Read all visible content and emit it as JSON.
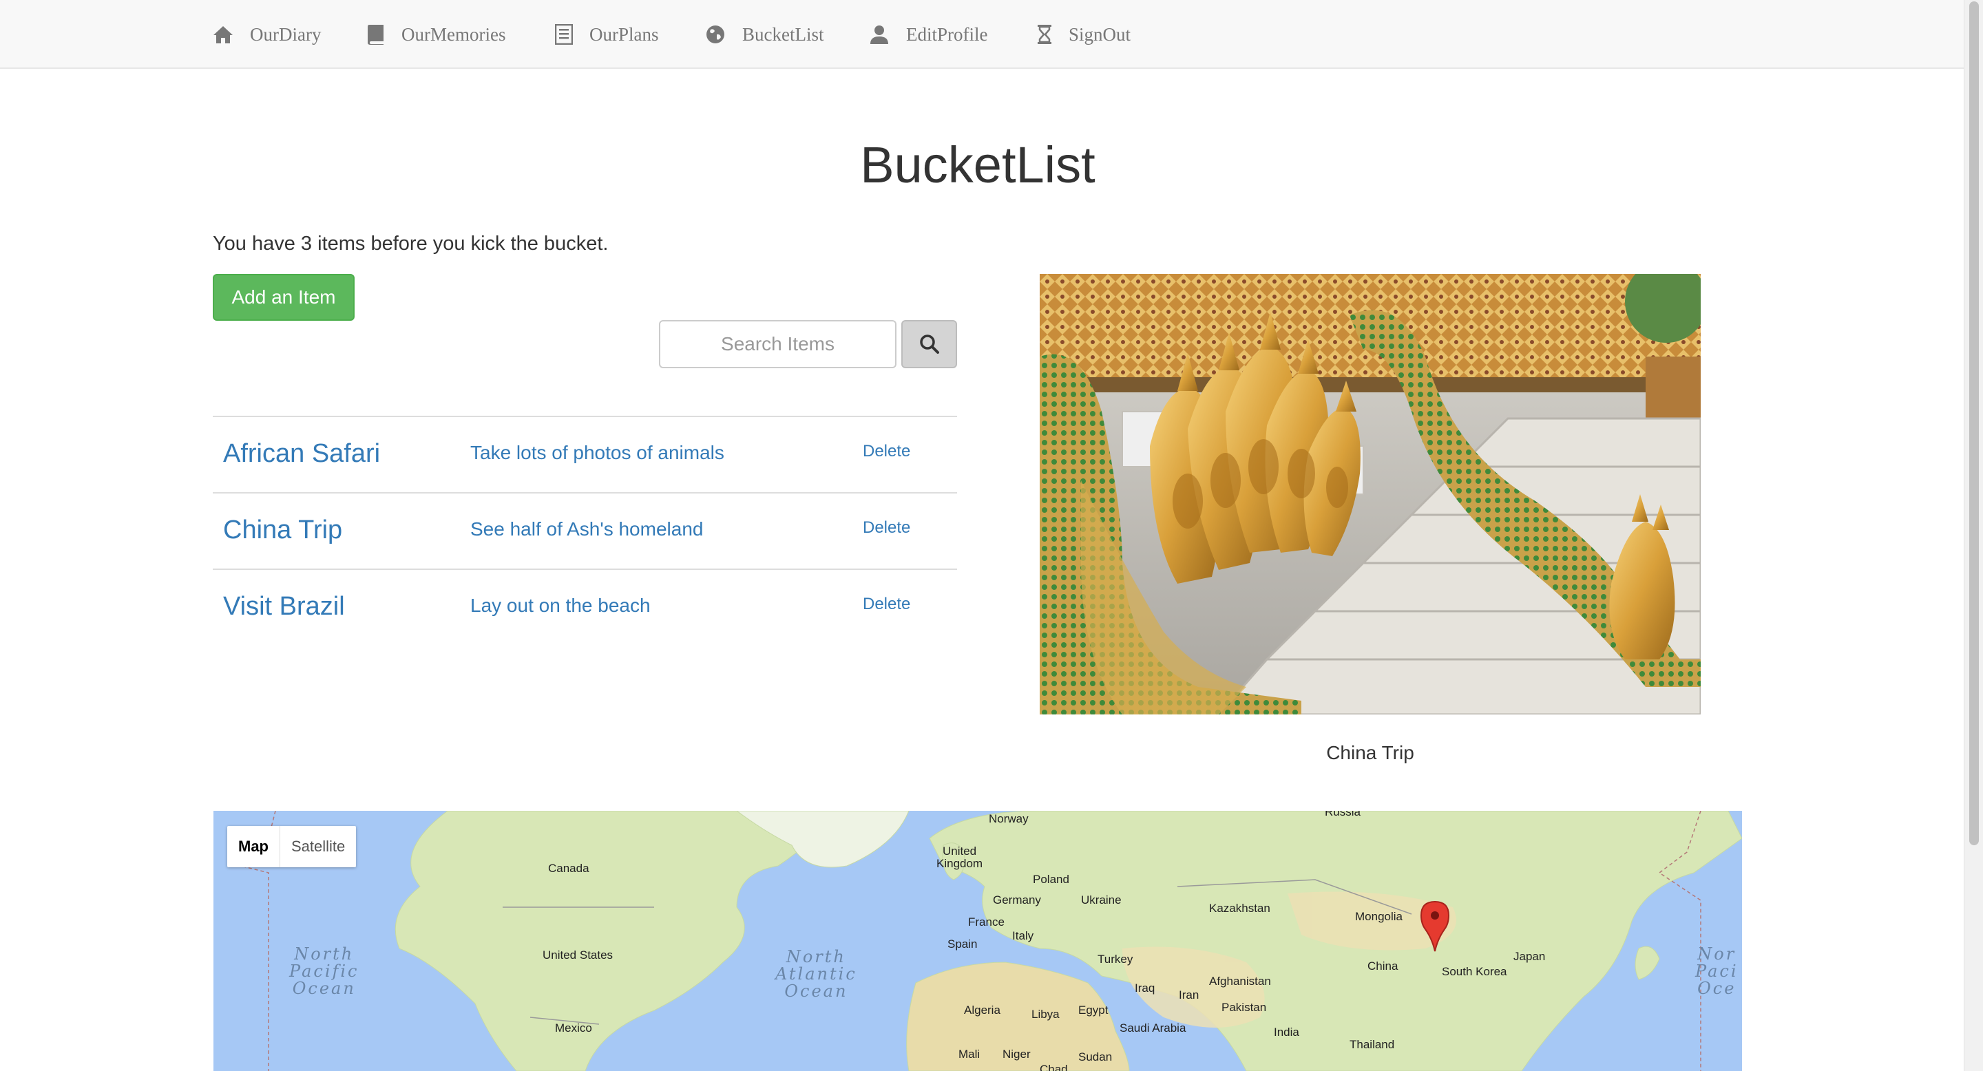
{
  "nav": {
    "items": [
      {
        "label": "OurDiary",
        "icon": "home-icon"
      },
      {
        "label": "OurMemories",
        "icon": "book-icon"
      },
      {
        "label": "OurPlans",
        "icon": "list-icon"
      },
      {
        "label": "BucketList",
        "icon": "globe-icon"
      },
      {
        "label": "EditProfile",
        "icon": "user-icon"
      },
      {
        "label": "SignOut",
        "icon": "hourglass-icon"
      }
    ]
  },
  "page": {
    "title": "BucketList",
    "count_text": "You have 3 items before you kick the bucket.",
    "add_button": "Add an Item",
    "search_placeholder": "Search Items",
    "search_icon": "search-icon"
  },
  "items": [
    {
      "title": "African Safari",
      "description": "Take lots of photos of animals",
      "delete": "Delete"
    },
    {
      "title": "China Trip",
      "description": "See half of Ash's homeland",
      "delete": "Delete"
    },
    {
      "title": "Visit Brazil",
      "description": "Lay out on the beach",
      "delete": "Delete"
    }
  ],
  "photo": {
    "caption": "China Trip"
  },
  "map": {
    "toggle_map": "Map",
    "toggle_satellite": "Satellite",
    "oceans": {
      "north_pacific": "North\nPacific\nOcean",
      "north_atlantic": "North\nAtlantic\nOcean",
      "north_pacific_right": "Nor\nPaci\nOce"
    },
    "labels": {
      "russia": "Russia",
      "norway": "Norway",
      "canada": "Canada",
      "united_kingdom": "United\nKingdom",
      "poland": "Poland",
      "germany": "Germany",
      "ukraine": "Ukraine",
      "kazakhstan": "Kazakhstan",
      "mongolia": "Mongolia",
      "france": "France",
      "italy": "Italy",
      "spain": "Spain",
      "united_states": "United States",
      "turkey": "Turkey",
      "iraq": "Iraq",
      "iran": "Iran",
      "afghanistan": "Afghanistan",
      "china": "China",
      "south_korea": "South Korea",
      "japan": "Japan",
      "pakistan": "Pakistan",
      "algeria": "Algeria",
      "libya": "Libya",
      "egypt": "Egypt",
      "saudi_arabia": "Saudi Arabia",
      "india": "India",
      "thailand": "Thailand",
      "mexico": "Mexico",
      "mali": "Mali",
      "niger": "Niger",
      "sudan": "Sudan",
      "chad": "Chad"
    },
    "marker_icon": "map-pin-icon"
  },
  "colors": {
    "link": "#337ab7",
    "success": "#5cb85c",
    "navbar_bg": "#f8f8f8",
    "ocean": "#a6c8f5",
    "land": "#d6e6b4",
    "marker": "#e53a2f"
  }
}
